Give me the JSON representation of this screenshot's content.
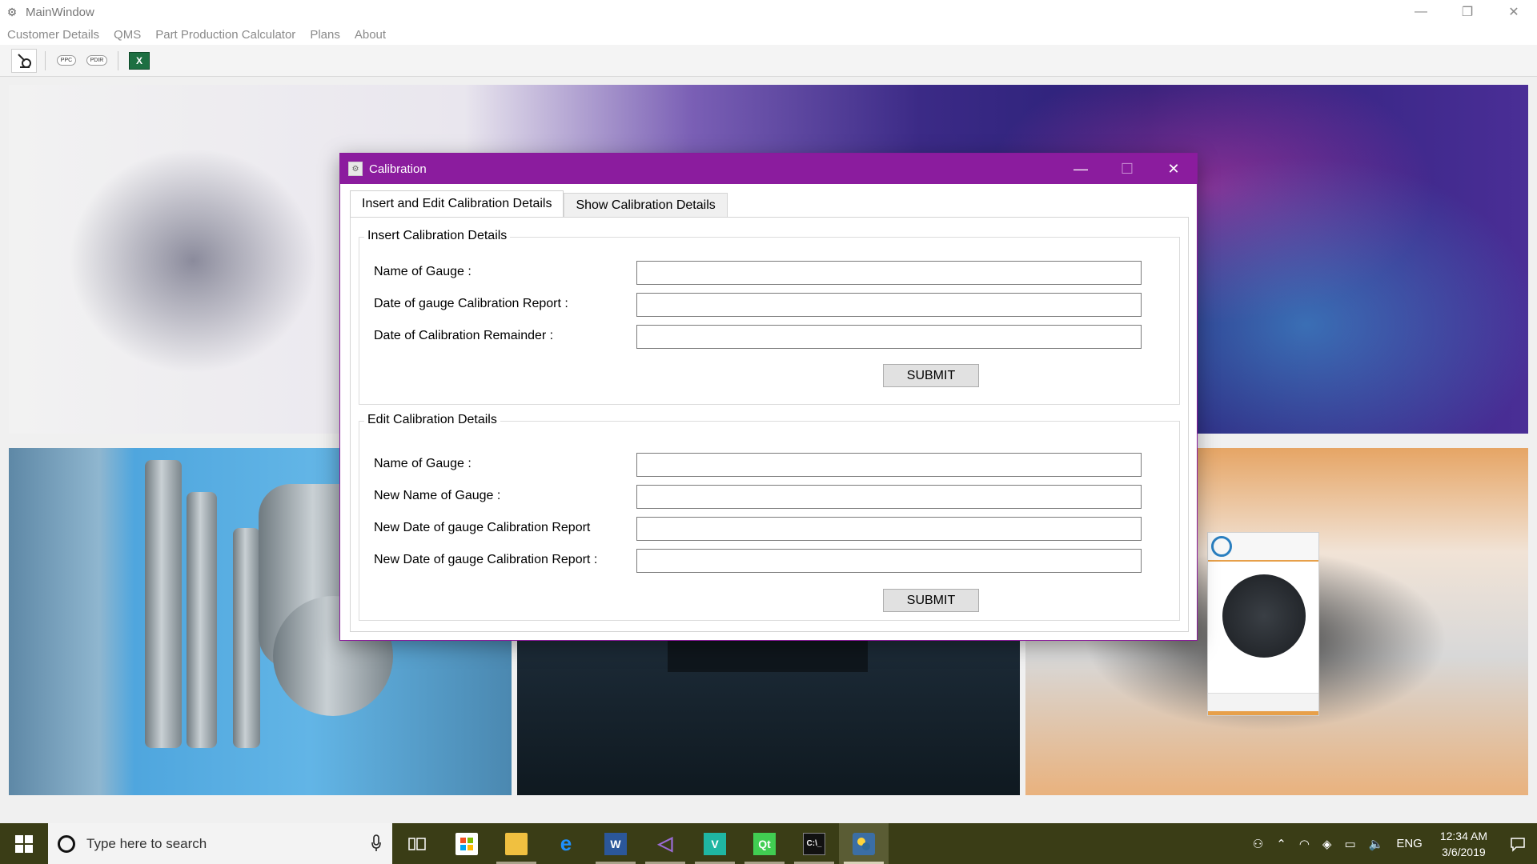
{
  "main_window": {
    "title": "MainWindow",
    "controls": {
      "minimize": "—",
      "restore": "❐",
      "close": "✕"
    }
  },
  "menubar": {
    "items": [
      "Customer Details",
      "QMS",
      "Part Production Calculator",
      "Plans",
      "About"
    ]
  },
  "toolbar": {
    "buttons": [
      {
        "icon": "gauge-icon"
      },
      {
        "icon": "ppc-icon",
        "label": "PPC"
      },
      {
        "icon": "pdir-icon",
        "label": "PDIR"
      },
      {
        "icon": "excel-icon",
        "label": "X"
      }
    ]
  },
  "dialog": {
    "title": "Calibration",
    "controls": {
      "minimize": "—",
      "maximize": "☐",
      "close": "✕"
    },
    "tabs": [
      {
        "label": "Insert and Edit Calibration Details",
        "active": true
      },
      {
        "label": "Show Calibration Details",
        "active": false
      }
    ],
    "insert_group": {
      "title": "Insert Calibration Details",
      "fields": [
        {
          "label": "Name of Gauge :",
          "value": ""
        },
        {
          "label": "Date of gauge Calibration Report :",
          "value": ""
        },
        {
          "label": "Date of Calibration Remainder :",
          "value": ""
        }
      ],
      "submit_label": "SUBMIT"
    },
    "edit_group": {
      "title": "Edit Calibration Details",
      "fields": [
        {
          "label": "Name of Gauge :",
          "value": ""
        },
        {
          "label": "New Name of Gauge :",
          "value": ""
        },
        {
          "label": "New Date of gauge Calibration Report",
          "value": ""
        },
        {
          "label": "New Date of gauge Calibration Report :",
          "value": ""
        }
      ],
      "submit_label": "SUBMIT"
    }
  },
  "taskbar": {
    "search_placeholder": "Type here to search",
    "apps": [
      "task-view-icon",
      "store-icon",
      "file-explorer-icon",
      "edge-icon",
      "word-icon",
      "visual-studio-icon",
      "maps-icon",
      "qt-creator-icon",
      "terminal-icon",
      "python-icon"
    ],
    "tray": {
      "language": "ENG",
      "time": "12:34 AM",
      "date": "3/6/2019"
    }
  },
  "colors": {
    "dialog_titlebar": "#8b1c9e",
    "taskbar": "#3a3d16"
  }
}
